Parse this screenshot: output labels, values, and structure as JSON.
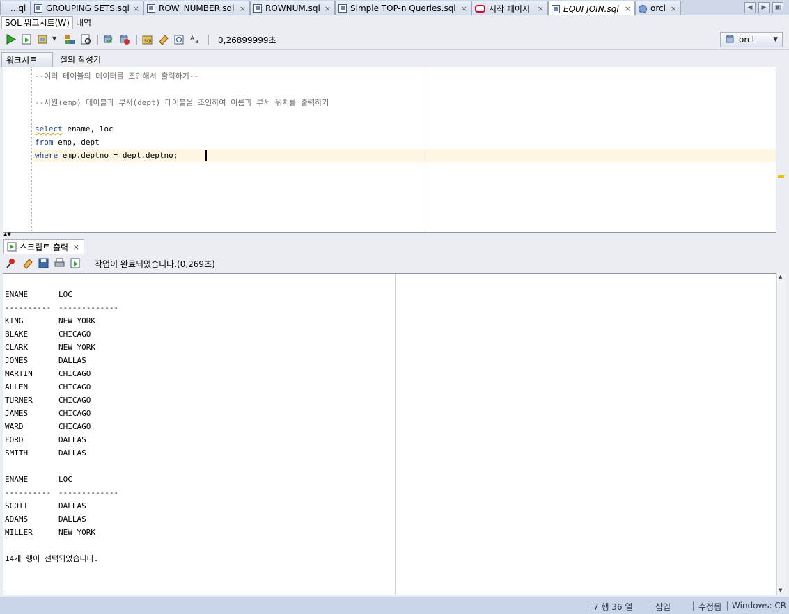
{
  "tabs": [
    {
      "label": "...ql",
      "icon": "none"
    },
    {
      "label": "GROUPING SETS.sql",
      "icon": "sql-file-icon"
    },
    {
      "label": "ROW_NUMBER.sql",
      "icon": "sql-file-icon"
    },
    {
      "label": "ROWNUM.sql",
      "icon": "sql-file-icon"
    },
    {
      "label": "Simple TOP-n Queries.sql",
      "icon": "sql-file-icon"
    },
    {
      "label": "시작 페이지",
      "icon": "oracle-icon"
    },
    {
      "label": "EQUI JOIN.sql",
      "icon": "sql-file-icon",
      "active": true
    },
    {
      "label": "orcl",
      "icon": "database-icon"
    }
  ],
  "subtabs": {
    "worksheet": "SQL 워크시트(W)",
    "history": "내역"
  },
  "toolbar": {
    "timing": "0,26899999초",
    "connection": "orcl"
  },
  "worksheet_tabs": {
    "worksheet": "워크시트",
    "query_builder": "질의 작성기"
  },
  "editor": {
    "line1": "--여러 테이블의 데이터를 조인해서 출력하기--",
    "line3": "--사원(emp) 테이블과 부서(dept) 테이블을 조인하여 이름과 부서 위치를 출력하기",
    "line5_kw": "select",
    "line5_rest": " ename, loc",
    "line6_kw": "from",
    "line6_rest": " emp, dept",
    "line7_kw": "where",
    "line7_rest": " emp.deptno = dept.deptno;"
  },
  "output": {
    "tab_label": "스크립트 출력",
    "status": "작업이 완료되었습니다.(0,269초)",
    "header": {
      "ename": "ENAME",
      "loc": "LOC"
    },
    "divider": {
      "ename": "----------",
      "loc": "-------------"
    },
    "rows_page1": [
      {
        "ename": "KING",
        "loc": "NEW YORK"
      },
      {
        "ename": "BLAKE",
        "loc": "CHICAGO"
      },
      {
        "ename": "CLARK",
        "loc": "NEW YORK"
      },
      {
        "ename": "JONES",
        "loc": "DALLAS"
      },
      {
        "ename": "MARTIN",
        "loc": "CHICAGO"
      },
      {
        "ename": "ALLEN",
        "loc": "CHICAGO"
      },
      {
        "ename": "TURNER",
        "loc": "CHICAGO"
      },
      {
        "ename": "JAMES",
        "loc": "CHICAGO"
      },
      {
        "ename": "WARD",
        "loc": "CHICAGO"
      },
      {
        "ename": "FORD",
        "loc": "DALLAS"
      },
      {
        "ename": "SMITH",
        "loc": "DALLAS"
      }
    ],
    "rows_page2": [
      {
        "ename": "SCOTT",
        "loc": "DALLAS"
      },
      {
        "ename": "ADAMS",
        "loc": "DALLAS"
      },
      {
        "ename": "MILLER",
        "loc": "NEW YORK"
      }
    ],
    "summary": "14개 행이 선택되었습니다."
  },
  "statusbar": {
    "position": "7 행 36 열",
    "mode": "삽입",
    "modified": "수정됨",
    "line_ending": "Windows: CR"
  }
}
